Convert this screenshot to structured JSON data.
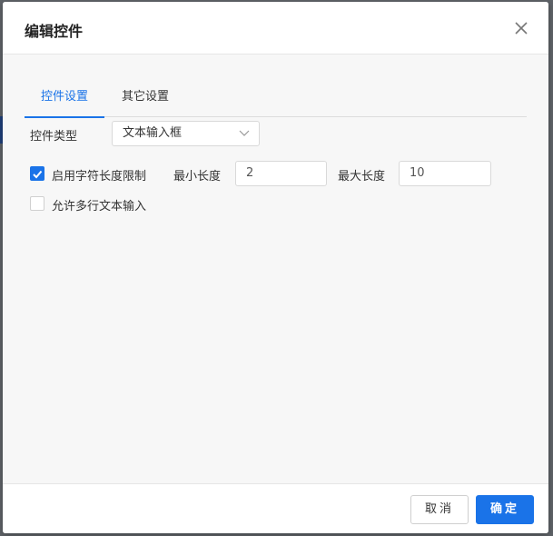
{
  "dialog": {
    "title": "编辑控件"
  },
  "tabs": [
    {
      "label": "控件设置",
      "active": true
    },
    {
      "label": "其它设置",
      "active": false
    }
  ],
  "control_type": {
    "label": "控件类型",
    "value": "文本输入框"
  },
  "length_limit": {
    "checkbox_label": "启用字符长度限制",
    "checked": true,
    "min_label": "最小长度",
    "min_value": "2",
    "max_label": "最大长度",
    "max_value": "10"
  },
  "multiline": {
    "checkbox_label": "允许多行文本输入",
    "checked": false
  },
  "footer": {
    "cancel_label": "取消",
    "ok_label": "确定"
  },
  "colors": {
    "accent": "#1a73e8"
  }
}
